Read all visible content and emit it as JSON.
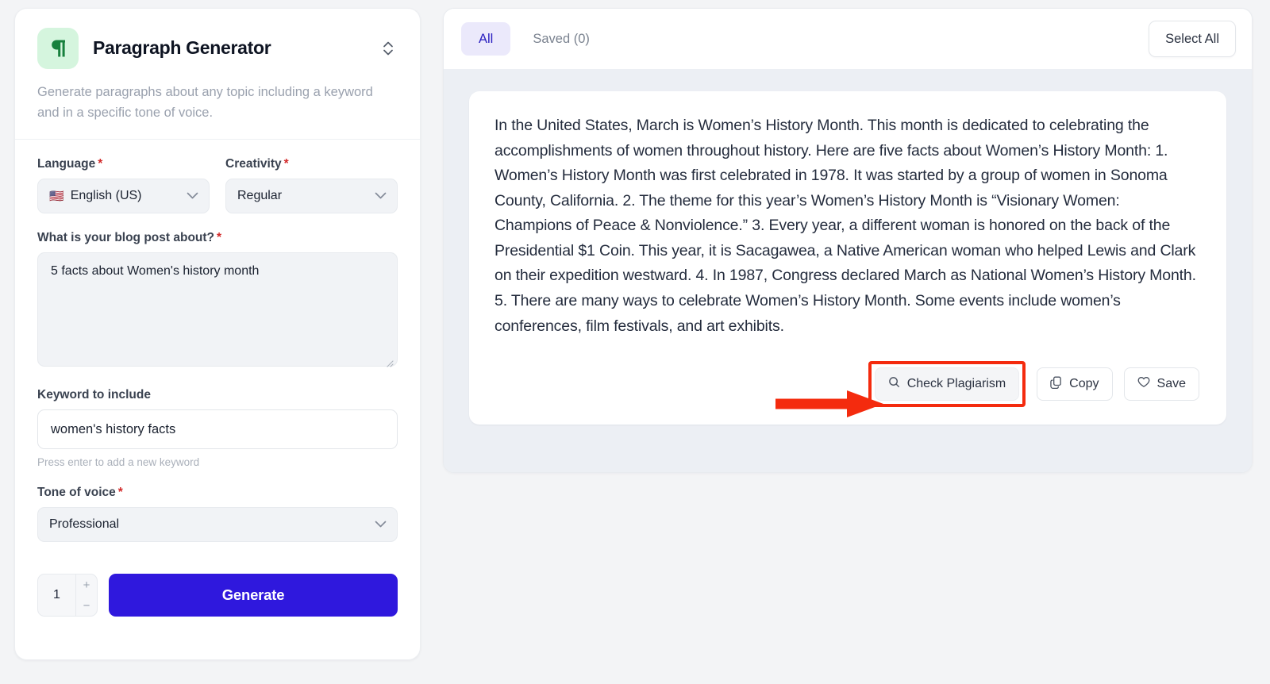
{
  "tool": {
    "icon": "paragraph-icon",
    "title": "Paragraph Generator",
    "description": "Generate paragraphs about any topic including a keyword and in a specific tone of voice.",
    "selector_icon": "chevron-up-down-icon"
  },
  "form": {
    "language": {
      "label": "Language",
      "required": "*",
      "value": "English (US)",
      "flag": "🇺🇸"
    },
    "creativity": {
      "label": "Creativity",
      "required": "*",
      "value": "Regular"
    },
    "prompt": {
      "label": "What is your blog post about?",
      "required": "*",
      "value": "5 facts about Women's history month",
      "placeholder": ""
    },
    "keyword": {
      "label": "Keyword to include",
      "value": "women's history facts",
      "placeholder": "",
      "hint": "Press enter to add a new keyword"
    },
    "tone": {
      "label": "Tone of voice",
      "required": "*",
      "value": "Professional"
    },
    "count": {
      "value": "1",
      "increment": "+",
      "decrement": "−"
    },
    "generate_label": "Generate"
  },
  "results": {
    "tabs": [
      {
        "label": "All",
        "active": true
      },
      {
        "label": "Saved (0)",
        "active": false
      }
    ],
    "select_all_label": "Select All",
    "items": [
      {
        "text": "In the United States, March is Women’s History Month. This month is dedicated to celebrating the accomplishments of women throughout history. Here are five facts about Women’s History Month: 1. Women’s History Month was first celebrated in 1978. It was started by a group of women in Sonoma County, California. 2. The theme for this year’s Women’s History Month is “Visionary Women: Champions of Peace & Nonviolence.” 3. Every year, a different woman is honored on the back of the Presidential $1 Coin. This year, it is Sacagawea, a Native American woman who helped Lewis and Clark on their expedition westward. 4. In 1987, Congress declared March as National Women’s History Month. 5. There are many ways to celebrate Women’s History Month. Some events include women’s conferences, film festivals, and art exhibits.",
        "actions": {
          "check_plagiarism": "Check Plagiarism",
          "copy": "Copy",
          "save": "Save"
        }
      }
    ]
  },
  "annotation": {
    "arrow_color": "#f42b0e",
    "highlight_color": "#f42b0e",
    "highlight_target": "Check Plagiarism"
  },
  "colors": {
    "accent": "#2f18dd",
    "tab_active_bg": "#ebe9fb",
    "tab_active_text": "#2a1fc0",
    "icon_bg": "#d5f5de",
    "page_bg": "#f3f4f6",
    "panel_bg": "#eceff4"
  }
}
